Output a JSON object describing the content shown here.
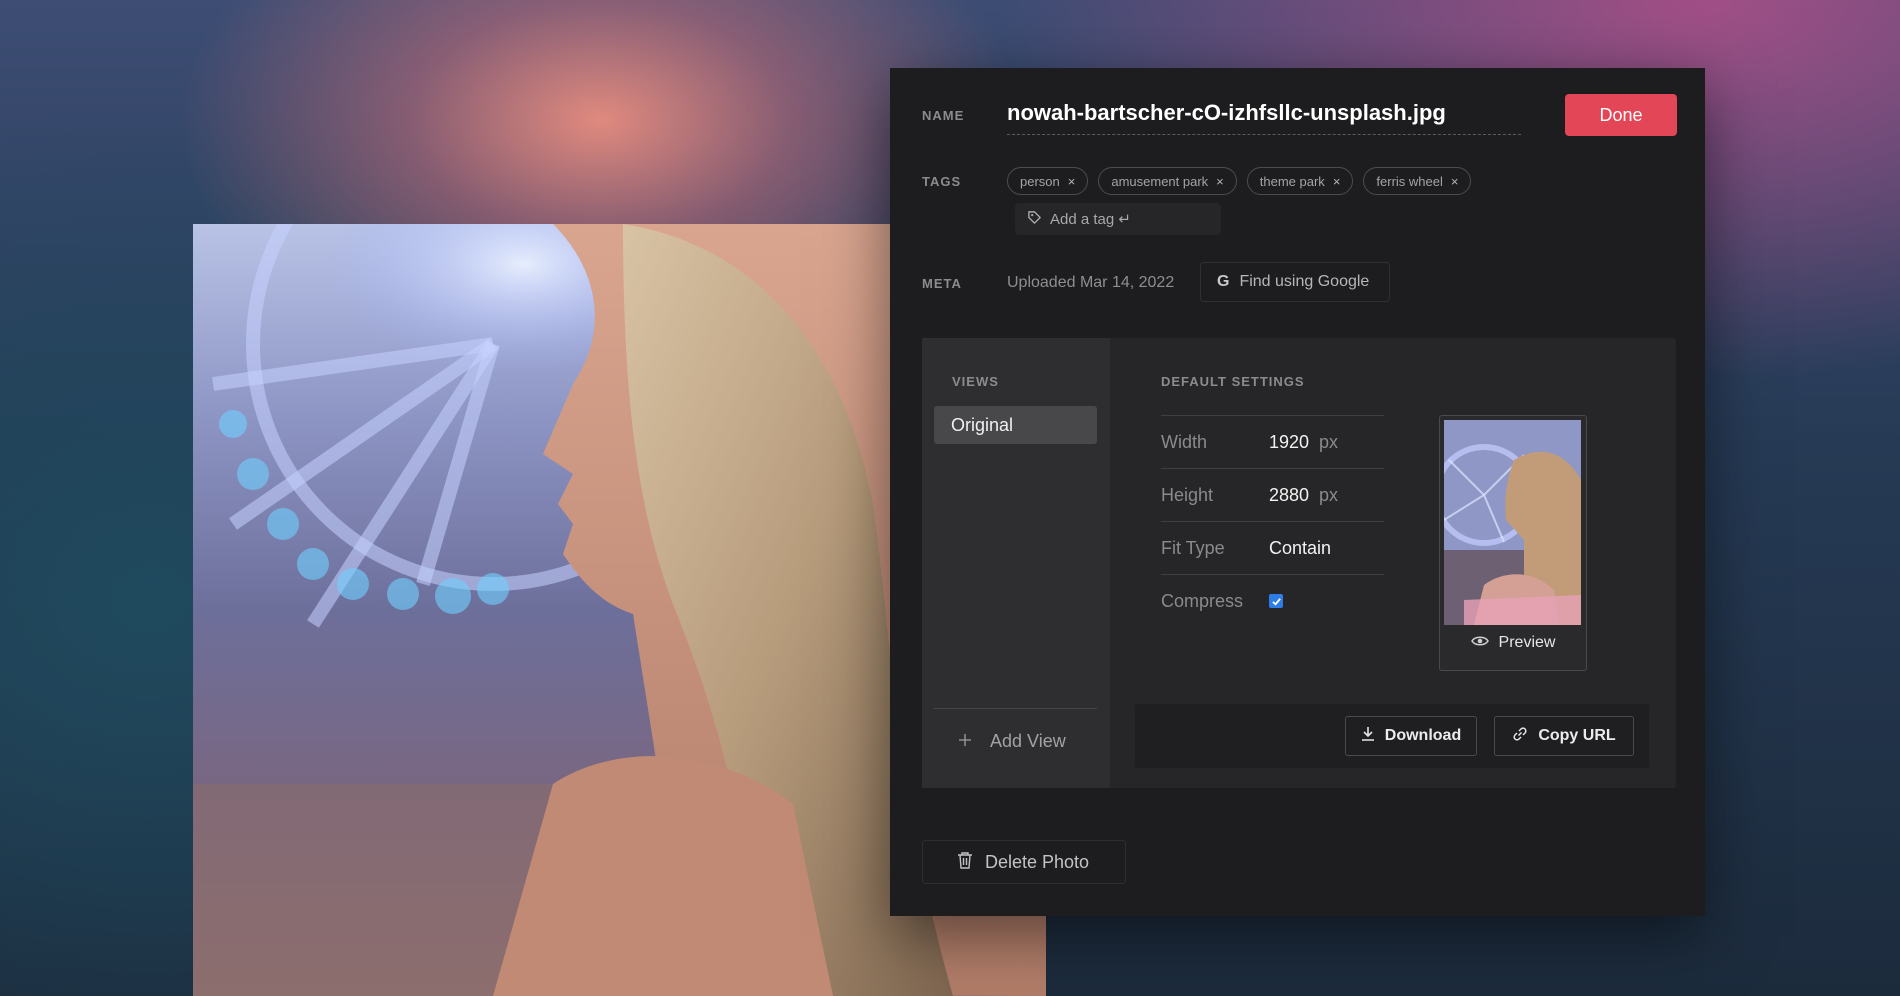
{
  "panel": {
    "name_label": "NAME",
    "filename": "nowah-bartscher-cO-izhfsllc-unsplash.jpg",
    "done_label": "Done",
    "tags_label": "TAGS",
    "tags": [
      {
        "label": "person"
      },
      {
        "label": "amusement park"
      },
      {
        "label": "theme park"
      },
      {
        "label": "ferris wheel"
      }
    ],
    "tag_remove_glyph": "×",
    "add_tag_label": "Add a tag ↵",
    "meta_label": "META",
    "uploaded_text": "Uploaded Mar 14, 2022",
    "google_letter": "G",
    "find_google_label": "Find using Google"
  },
  "views": {
    "title": "VIEWS",
    "items": [
      {
        "label": "Original"
      }
    ],
    "add_view_label": "Add View"
  },
  "settings": {
    "title": "DEFAULT SETTINGS",
    "width_label": "Width",
    "width_value": "1920",
    "width_unit": "px",
    "height_label": "Height",
    "height_value": "2880",
    "height_unit": "px",
    "fit_label": "Fit Type",
    "fit_value": "Contain",
    "compress_label": "Compress",
    "compress_checked": true,
    "preview_label": "Preview"
  },
  "actions": {
    "download_label": "Download",
    "copy_url_label": "Copy URL"
  },
  "delete_label": "Delete Photo",
  "colors": {
    "accent": "#e34656",
    "checkbox": "#2c7de6",
    "panel_bg": "#1d1d1f"
  },
  "icons": [
    "tag-icon",
    "google-icon",
    "plus-icon",
    "eye-icon",
    "download-icon",
    "link-icon",
    "trash-icon",
    "close-icon"
  ]
}
